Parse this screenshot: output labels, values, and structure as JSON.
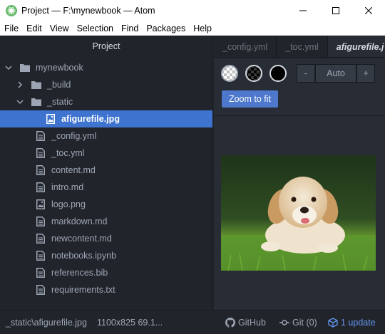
{
  "window": {
    "title": "Project — F:\\mynewbook — Atom"
  },
  "menu": [
    "File",
    "Edit",
    "View",
    "Selection",
    "Find",
    "Packages",
    "Help"
  ],
  "tree": {
    "header": "Project",
    "root": "mynewbook",
    "items": [
      {
        "label": "mynewbook",
        "kind": "folder",
        "expanded": true,
        "depth": 0
      },
      {
        "label": "_build",
        "kind": "folder",
        "expanded": false,
        "depth": 1
      },
      {
        "label": "_static",
        "kind": "folder",
        "expanded": true,
        "depth": 1
      },
      {
        "label": "afigurefile.jpg",
        "kind": "image",
        "depth": 2,
        "selected": true
      },
      {
        "label": "_config.yml",
        "kind": "file",
        "depth": 1
      },
      {
        "label": "_toc.yml",
        "kind": "file",
        "depth": 1
      },
      {
        "label": "content.md",
        "kind": "file",
        "depth": 1
      },
      {
        "label": "intro.md",
        "kind": "file",
        "depth": 1
      },
      {
        "label": "logo.png",
        "kind": "image",
        "depth": 1
      },
      {
        "label": "markdown.md",
        "kind": "file",
        "depth": 1
      },
      {
        "label": "newcontent.md",
        "kind": "file",
        "depth": 1
      },
      {
        "label": "notebooks.ipynb",
        "kind": "file",
        "depth": 1
      },
      {
        "label": "references.bib",
        "kind": "file",
        "depth": 1
      },
      {
        "label": "requirements.txt",
        "kind": "file",
        "depth": 1
      }
    ]
  },
  "tabs": [
    {
      "label": "_config.yml",
      "active": false
    },
    {
      "label": "_toc.yml",
      "active": false
    },
    {
      "label": "afigurefile.j",
      "active": true
    }
  ],
  "viewer": {
    "zoom_minus": "-",
    "zoom_value": "Auto",
    "zoom_plus": "+",
    "fit_label": "Zoom to fit"
  },
  "status": {
    "path": "_static\\afigurefile.jpg",
    "dimensions": "1100x825 69.1...",
    "github": "GitHub",
    "git": "Git (0)",
    "update": "1 update"
  },
  "colors": {
    "selection": "#3e74cf",
    "accent_button": "#4d78cc",
    "update_link": "#6494ed"
  }
}
